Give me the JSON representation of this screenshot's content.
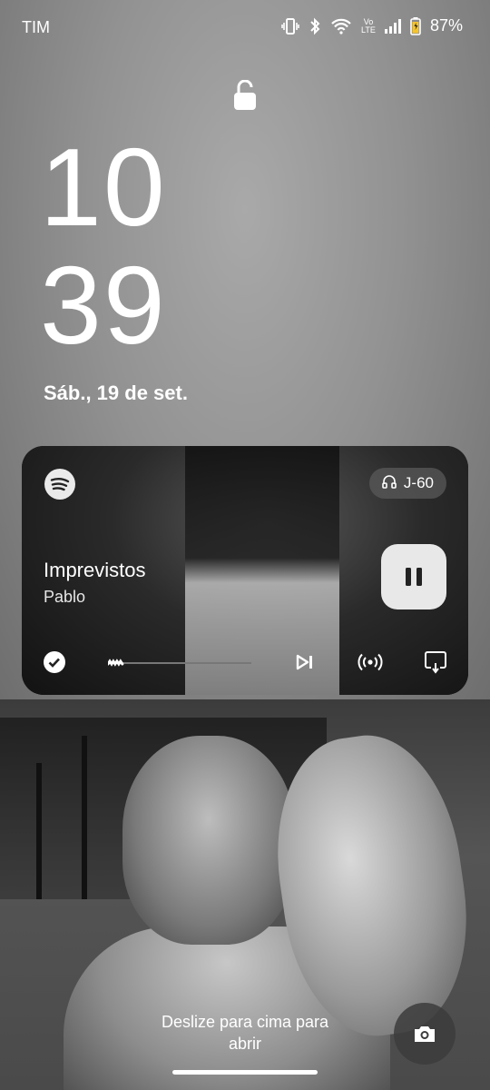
{
  "status_bar": {
    "carrier": "TIM",
    "volte_label": "Vo LTE",
    "battery_percent": "87%",
    "icons": [
      "vibrate-icon",
      "bluetooth-icon",
      "wifi-icon",
      "volte-icon",
      "signal-icon",
      "battery-icon"
    ]
  },
  "lock": {
    "icon": "unlocked-padlock-icon"
  },
  "clock": {
    "hour": "10",
    "minute": "39"
  },
  "date": "Sáb., 19 de set.",
  "media": {
    "app_icon": "spotify-icon",
    "output_device": "J-60",
    "output_icon": "headphones-icon",
    "track_title": "Imprevistos",
    "artist": "Pablo",
    "progress": 0.1,
    "controls": [
      "liked-check-icon",
      "skip-next-icon",
      "connect-devices-icon",
      "cast-icon"
    ],
    "play_state_icon": "pause-icon"
  },
  "unlock_hint": {
    "line1": "Deslize para cima para",
    "line2": "abrir"
  },
  "camera_shortcut": {
    "icon": "camera-icon"
  }
}
